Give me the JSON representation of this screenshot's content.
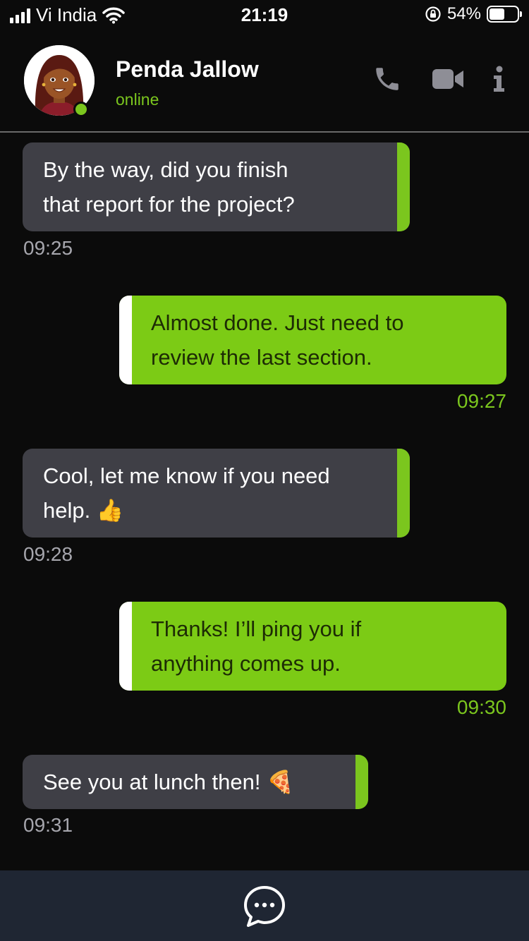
{
  "status_bar": {
    "carrier": "Vi India",
    "time": "21:19",
    "battery_percent": "54%",
    "battery_level": 0.54,
    "icons": [
      "signal-icon",
      "wifi-icon",
      "orientation-lock-icon",
      "battery-icon"
    ]
  },
  "header": {
    "name": "Penda Jallow",
    "status": "online",
    "actions": [
      "phone-icon",
      "video-icon",
      "info-icon"
    ]
  },
  "messages": [
    {
      "direction": "incoming",
      "lines": [
        "By the way, did you finish",
        "that report for the project?"
      ],
      "time": "09:25"
    },
    {
      "direction": "outgoing",
      "lines": [
        "Almost done. Just need to",
        "review the last section."
      ],
      "time": "09:27"
    },
    {
      "direction": "incoming",
      "lines": [
        "Cool, let me know if you need",
        "help. 👍"
      ],
      "time": "09:28"
    },
    {
      "direction": "outgoing",
      "lines": [
        "Thanks! I’ll ping you if",
        "anything comes up."
      ],
      "time": "09:30"
    },
    {
      "direction": "incoming",
      "lines": [
        "See you at lunch then! 🍕"
      ],
      "time": "09:31"
    }
  ],
  "bottom_bar": {
    "icon": "chat-compose-icon"
  },
  "colors": {
    "accent_green": "#7bc61e",
    "outgoing_bubble": "#7ccb15",
    "incoming_bubble": "#3f3f46",
    "background": "#0b0b0b",
    "bottom_bar": "#1f2633"
  }
}
